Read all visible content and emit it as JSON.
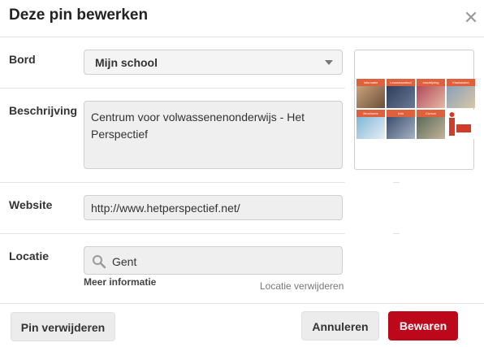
{
  "dialog": {
    "title": "Deze pin bewerken",
    "close_icon": "close-icon"
  },
  "fields": {
    "board": {
      "label": "Bord",
      "value": "Mijn school",
      "icon": "chevron-down-icon"
    },
    "description": {
      "label": "Beschrijving",
      "value": "Centrum voor volwassenenonderwijs - Het Perspectief"
    },
    "website": {
      "label": "Website",
      "value": "http://www.hetperspectief.net/"
    },
    "location": {
      "label": "Locatie",
      "value": "Gent",
      "icon": "search-icon",
      "more_info": "Meer informatie",
      "remove": "Locatie verwijderen"
    }
  },
  "thumbnail": {
    "tiles": [
      "Informatie",
      "Lessenaanbod",
      "Inschrijving",
      "Klaslokalen",
      "Brochures",
      "Info",
      "Cursus",
      "Info"
    ]
  },
  "buttons": {
    "delete": "Pin verwijderen",
    "cancel": "Annuleren",
    "save": "Bewaren"
  },
  "colors": {
    "accent": "#bd081c",
    "tile_header": "#e0603b",
    "field_bg": "#efefef"
  }
}
